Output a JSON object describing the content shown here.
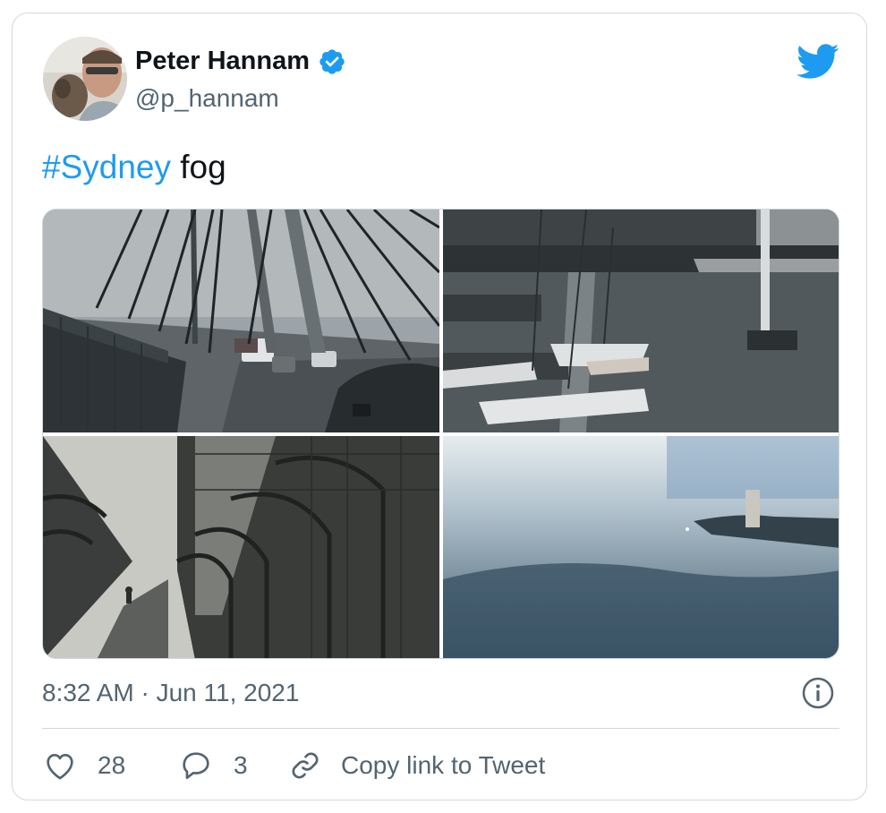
{
  "author": {
    "display_name": "Peter Hannam",
    "handle": "@p_hannam",
    "verified": true,
    "avatar_icon": "profile-photo"
  },
  "tweet": {
    "hashtag": "#Sydney",
    "text": " fog",
    "timestamp": "8:32 AM · Jun 11, 2021"
  },
  "media": [
    {
      "name": "photo-bridge-cables-traffic",
      "icon": "photo"
    },
    {
      "name": "photo-harbour-yachts",
      "icon": "photo"
    },
    {
      "name": "photo-bridge-walkway",
      "icon": "photo"
    },
    {
      "name": "photo-foggy-harbour",
      "icon": "photo"
    }
  ],
  "actions": {
    "like_count": "28",
    "reply_count": "3",
    "copy_link_label": "Copy link to Tweet"
  },
  "colors": {
    "accent": "#1d9bf0",
    "text": "#0f1419",
    "muted": "#536471",
    "border": "#cfd9de"
  }
}
